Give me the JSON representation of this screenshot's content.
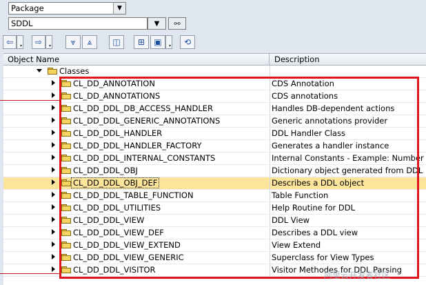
{
  "selection": {
    "object_type": "Package",
    "object_name": "SDDL"
  },
  "icons": {
    "dropdown": "chevron-down-icon",
    "find": "binoculars-icon",
    "back": "arrow-left-icon",
    "forward": "arrow-right-icon",
    "expand_all": "expand-all-icon",
    "collapse_all": "collapse-all-icon",
    "display": "display-icon",
    "hierarchy": "hierarchy-icon",
    "object_list": "object-list-icon",
    "refresh": "refresh-icon"
  },
  "tree": {
    "columns": [
      "Object Name",
      "Description"
    ],
    "root": {
      "label": "Classes"
    },
    "rows": [
      {
        "name": "CL_DD_ANNOTATION",
        "desc": "CDS Annotation"
      },
      {
        "name": "CL_DD_ANNOTATIONS",
        "desc": "CDS annotations"
      },
      {
        "name": "CL_DD_DDL_DB_ACCESS_HANDLER",
        "desc": "Handles DB-dependent actions"
      },
      {
        "name": "CL_DD_DDL_GENERIC_ANNOTATIONS",
        "desc": "Generic annotations provider"
      },
      {
        "name": "CL_DD_DDL_HANDLER",
        "desc": "DDL Handler Class"
      },
      {
        "name": "CL_DD_DDL_HANDLER_FACTORY",
        "desc": "Generates a handler instance"
      },
      {
        "name": "CL_DD_DDL_INTERNAL_CONSTANTS",
        "desc": "Internal Constants - Example: Number of"
      },
      {
        "name": "CL_DD_DDL_OBJ",
        "desc": "Dictionary object generated from DDL"
      },
      {
        "name": "CL_DD_DDL_OBJ_DEF",
        "desc": "Describes a DDL object"
      },
      {
        "name": "CL_DD_DDL_TABLE_FUNCTION",
        "desc": "Table Function"
      },
      {
        "name": "CL_DD_DDL_UTILITIES",
        "desc": "Help Routine for DDL"
      },
      {
        "name": "CL_DD_DDL_VIEW",
        "desc": "DDL View"
      },
      {
        "name": "CL_DD_DDL_VIEW_DEF",
        "desc": "Describes a DDL view"
      },
      {
        "name": "CL_DD_DDL_VIEW_EXTEND",
        "desc": "View Extend"
      },
      {
        "name": "CL_DD_DDL_VIEW_GENERIC",
        "desc": "Superclass for View Types"
      },
      {
        "name": "CL_DD_DDL_VISITOR",
        "desc": "Visitor Methodes for DDL Parsing"
      }
    ],
    "selected_index": 8
  },
  "colors": {
    "highlight_box": "#e0141b",
    "selected_row": "#fde49b"
  },
  "watermark": "阿里云开发者社区"
}
